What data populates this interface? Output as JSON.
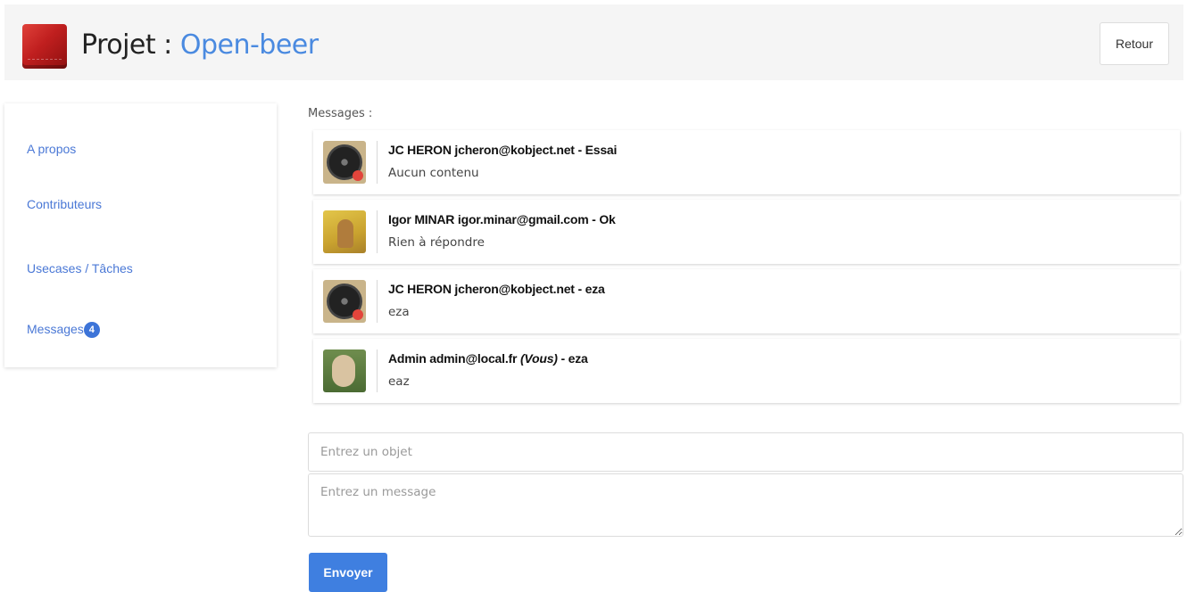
{
  "header": {
    "title_prefix": "Projet : ",
    "project_name": "Open-beer",
    "back_label": "Retour"
  },
  "sidebar": {
    "items": [
      {
        "label": "A propos"
      },
      {
        "label": "Contributeurs"
      },
      {
        "label": "Usecases / Tâches"
      },
      {
        "label": "Messages",
        "badge": "4"
      }
    ]
  },
  "main": {
    "messages_label": "Messages :",
    "messages": [
      {
        "author": "JC HERON jcheron@kobject.net",
        "subject": "Essai",
        "body": "Aucun contenu",
        "avatar": "vinyl-avatar"
      },
      {
        "author": "Igor MINAR igor.minar@gmail.com",
        "subject": "Ok",
        "body": "Rien à répondre",
        "avatar": "cat-avatar"
      },
      {
        "author": "JC HERON jcheron@kobject.net",
        "subject": "eza",
        "body": "eza",
        "avatar": "vinyl-avatar"
      },
      {
        "author": "Admin admin@local.fr",
        "you_tag": "(Vous)",
        "subject": "eza",
        "body": "eaz",
        "avatar": "lion-avatar"
      }
    ],
    "form": {
      "subject_placeholder": "Entrez un objet",
      "message_placeholder": "Entrez un message",
      "send_label": "Envoyer"
    }
  },
  "colors": {
    "accent": "#4a8ae0",
    "link": "#4a78d6",
    "badge": "#3d74d8",
    "button": "#3f7fe0",
    "header_bg": "#f5f5f5"
  }
}
